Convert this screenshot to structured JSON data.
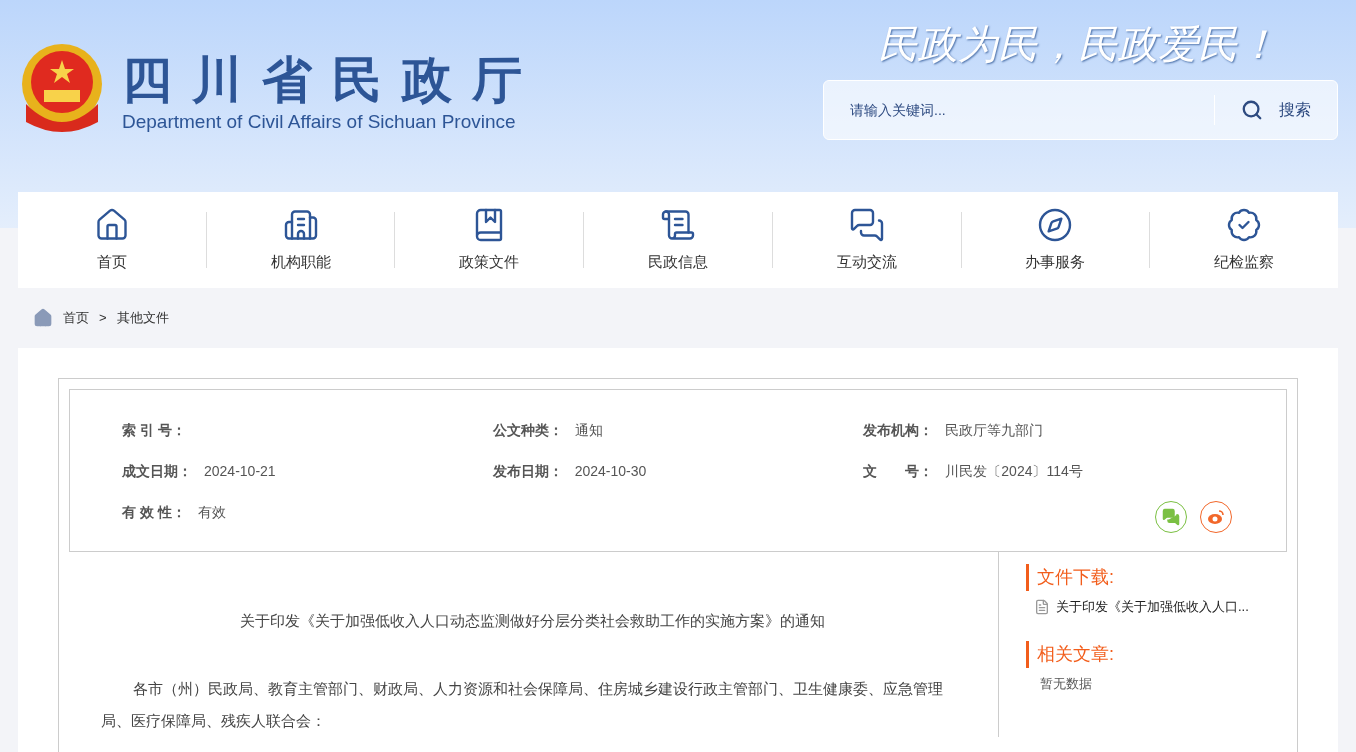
{
  "header": {
    "title": "四川省民政厅",
    "subtitle": "Department of Civil Affairs of Sichuan Province",
    "slogan": "民政为民，民政爱民！",
    "search": {
      "placeholder": "请输入关键词...",
      "button": "搜索"
    }
  },
  "nav": [
    {
      "label": "首页"
    },
    {
      "label": "机构职能"
    },
    {
      "label": "政策文件"
    },
    {
      "label": "民政信息"
    },
    {
      "label": "互动交流"
    },
    {
      "label": "办事服务"
    },
    {
      "label": "纪检监察"
    }
  ],
  "breadcrumb": [
    "首页",
    ">",
    "其他文件"
  ],
  "meta": [
    {
      "label": "索 引 号："
    },
    {
      "label": "公文种类：",
      "value": "通知"
    },
    {
      "label": "发布机构：",
      "value": "民政厅等九部门"
    },
    {
      "label": "成文日期：",
      "value": "2024-10-21"
    },
    {
      "label": "发布日期：",
      "value": "2024-10-30"
    },
    {
      "label": "文　　号：",
      "value": "川民发〔2024〕114号"
    },
    {
      "label": "有 效 性：",
      "value": "有效"
    }
  ],
  "article": {
    "title": "关于印发《关于加强低收入人口动态监测做好分层分类社会救助工作的实施方案》的通知",
    "paragraphs": [
      "各市（州）民政局、教育主管部门、财政局、人力资源和社会保障局、住房城乡建设行政主管部门、卫生健康委、应急管理局、医疗保障局、残疾人联合会："
    ]
  },
  "sidebar": [
    {
      "heading": "文件下载:",
      "items": [
        {
          "kind": "file",
          "text": "关于印发《关于加强低收入人口..."
        }
      ]
    },
    {
      "heading": "相关文章:",
      "items": [
        {
          "kind": "empty",
          "text": "暂无数据"
        }
      ]
    }
  ]
}
